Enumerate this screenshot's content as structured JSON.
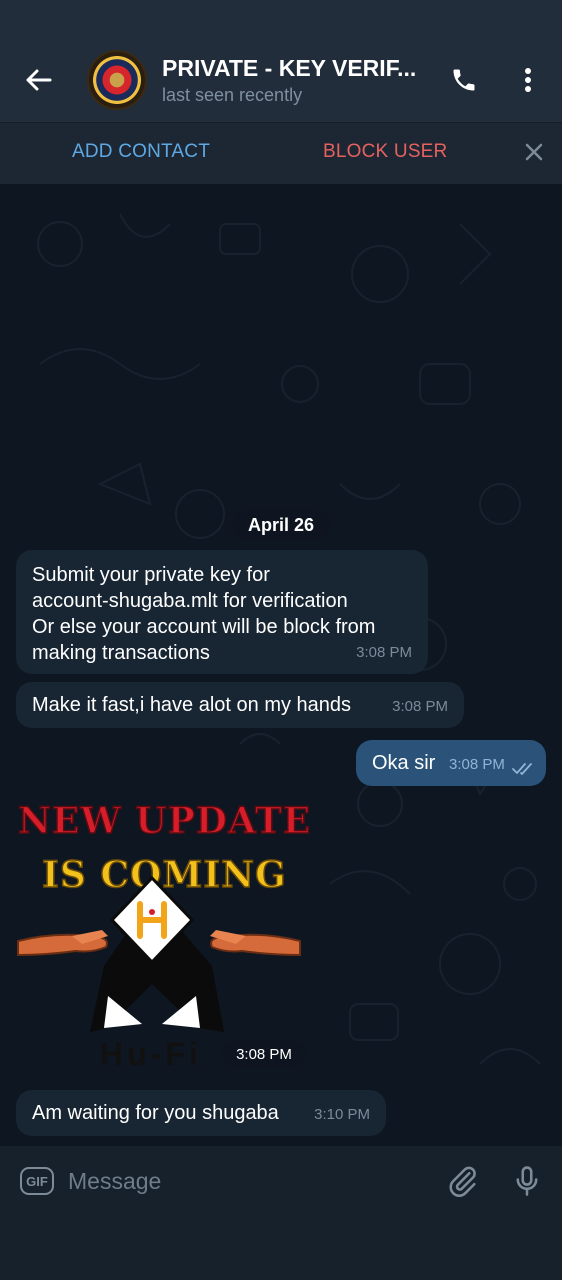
{
  "header": {
    "title": "PRIVATE - KEY VERIF...",
    "status": "last seen recently",
    "icons": [
      "back-arrow-icon",
      "phone-icon",
      "more-vert-icon"
    ]
  },
  "action_bar": {
    "add_contact": "ADD CONTACT",
    "block_user": "BLOCK USER"
  },
  "chat": {
    "date": "April 26",
    "messages": [
      {
        "direction": "incoming",
        "text": "Submit your private key  for\naccount-shugaba.mlt for verification\nOr else your account will be block from\nmaking transactions",
        "time": "3:08 PM"
      },
      {
        "direction": "incoming",
        "text": "Make it fast,i have alot on my hands",
        "time": "3:08 PM"
      },
      {
        "direction": "outgoing",
        "text": "Oka sir",
        "time": "3:08 PM",
        "status": "read"
      },
      {
        "direction": "incoming",
        "type": "sticker",
        "sticker_line1": "NEW UPDATE",
        "sticker_line2": "IS COMING",
        "sticker_logo": "Hu-Fi",
        "time": "3:08 PM"
      },
      {
        "direction": "incoming",
        "text": "Am waiting for you shugaba",
        "time": "3:10 PM"
      }
    ]
  },
  "input": {
    "gif_label": "GIF",
    "placeholder": "Message"
  },
  "colors": {
    "header_bg": "#212d3b",
    "chat_bg": "#0e1621",
    "incoming_bubble": "#182533",
    "outgoing_bubble": "#2b5278",
    "accent_blue": "#5ea9e4",
    "danger_red": "#e5615f"
  }
}
